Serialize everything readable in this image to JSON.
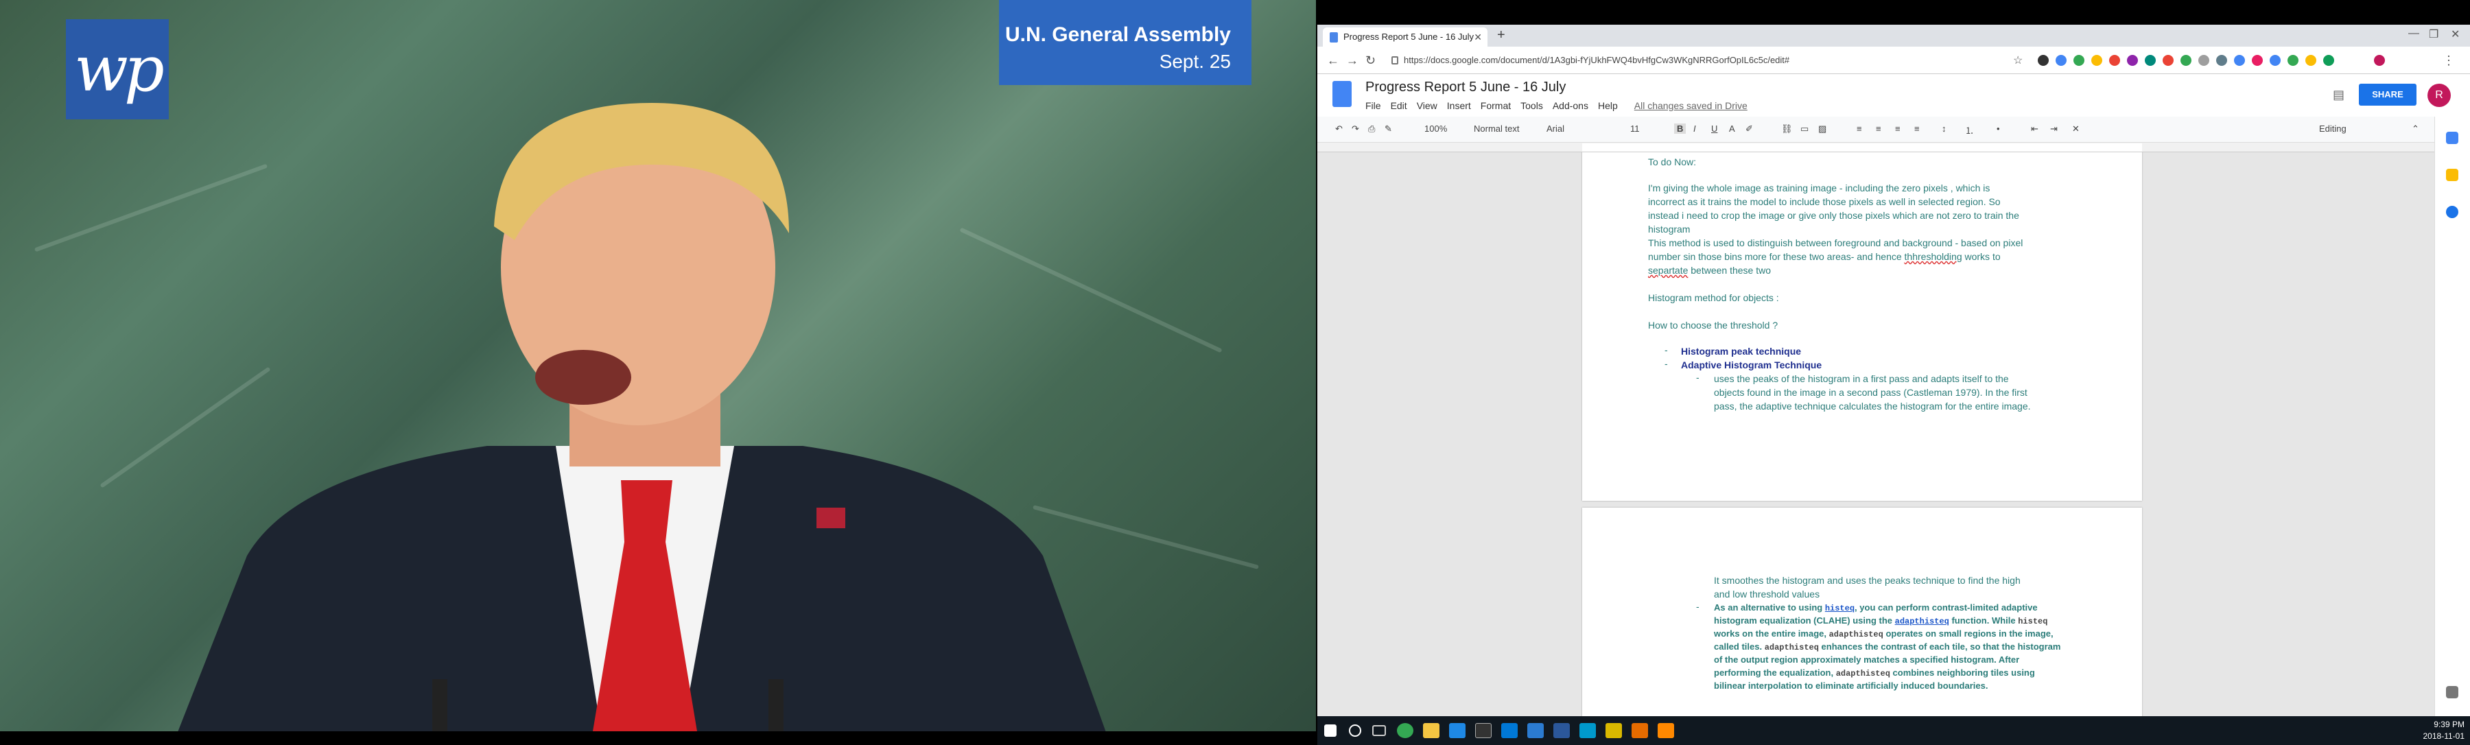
{
  "video": {
    "logo": "wp",
    "lower_third": {
      "line1": "U.N. General Assembly",
      "line2": "Sept. 25"
    },
    "colors": {
      "brand": "#2e68c0",
      "background": "#4a6e58"
    }
  },
  "browser": {
    "tab_title": "Progress Report 5 June - 16 July",
    "url": "https://docs.google.com/document/d/1A3gbi-fYjUkhFWQ4bvHfgCw3WKgNRRGorfOpIL6c5c/edit#"
  },
  "docs": {
    "title": "Progress Report 5 June - 16 July",
    "menu": [
      "File",
      "Edit",
      "View",
      "Insert",
      "Format",
      "Tools",
      "Add-ons",
      "Help"
    ],
    "saved_status": "All changes saved in Drive",
    "share_label": "SHARE",
    "avatar_letter": "R",
    "toolbar": {
      "zoom": "100%",
      "style": "Normal text",
      "font": "Arial",
      "size": "11",
      "mode": "Editing"
    }
  },
  "document": {
    "todo": "To do Now:",
    "para1_l1": "I'm giving the whole image as training image - including the zero pixels , which is",
    "para1_l2": "incorrect as it trains the model to include those pixels as well in selected region. So",
    "para1_l3": "instead i need to crop the image or give only those pixels which are not zero to train the",
    "para1_l4": "histogram",
    "para2_l1": "This method is used to distinguish between foreground and background - based on pixel",
    "para2_l2_a": "number sin those bins more for these two areas- and hence ",
    "para2_l2_b": "thhresholding",
    "para2_l2_c": " works to",
    "para2_l3_a": "separtate",
    "para2_l3_b": " between these two",
    "heading1": "Histogram method for objects :",
    "heading2": "How to choose the threshold ?",
    "item1": "Histogram peak technique",
    "item2": "Adaptive Histogram Technique",
    "sub1_l1": "uses the peaks of the histogram in a first pass and adapts itself to the",
    "sub1_l2": "objects found in the image in a second pass (Castleman 1979). In the first",
    "sub1_l3": "pass, the adaptive technique calculates the histogram for the entire image.",
    "p2_l1": "It smoothes the histogram and uses the peaks technique to find the high",
    "p2_l2": "and low threshold values",
    "p2b_l1_a": "As an alternative to using ",
    "p2b_l1_b": "histeq",
    "p2b_l1_c": ", you can perform contrast-limited adaptive",
    "p2b_l2_a": "histogram equalization (CLAHE) using the ",
    "p2b_l2_b": "adapthisteq",
    "p2b_l2_c": " function. While ",
    "p2b_l2_d": "histeq",
    "p2b_l3_a": "works on the entire image, ",
    "p2b_l3_b": "adapthisteq",
    "p2b_l3_c": " operates on small regions in the image,",
    "p2b_l4_a": "called tiles. ",
    "p2b_l4_b": "adapthisteq",
    "p2b_l4_c": " enhances the contrast of each tile, so that the histogram",
    "p2b_l5": "of the output region approximately matches a specified histogram. After",
    "p2b_l6_a": "performing the equalization, ",
    "p2b_l6_b": "adapthisteq",
    "p2b_l6_c": " combines neighboring tiles using",
    "p2b_l7": "bilinear interpolation to eliminate artificially induced boundaries."
  },
  "taskbar": {
    "time": "9:39 PM",
    "date": "2018-11-01"
  }
}
